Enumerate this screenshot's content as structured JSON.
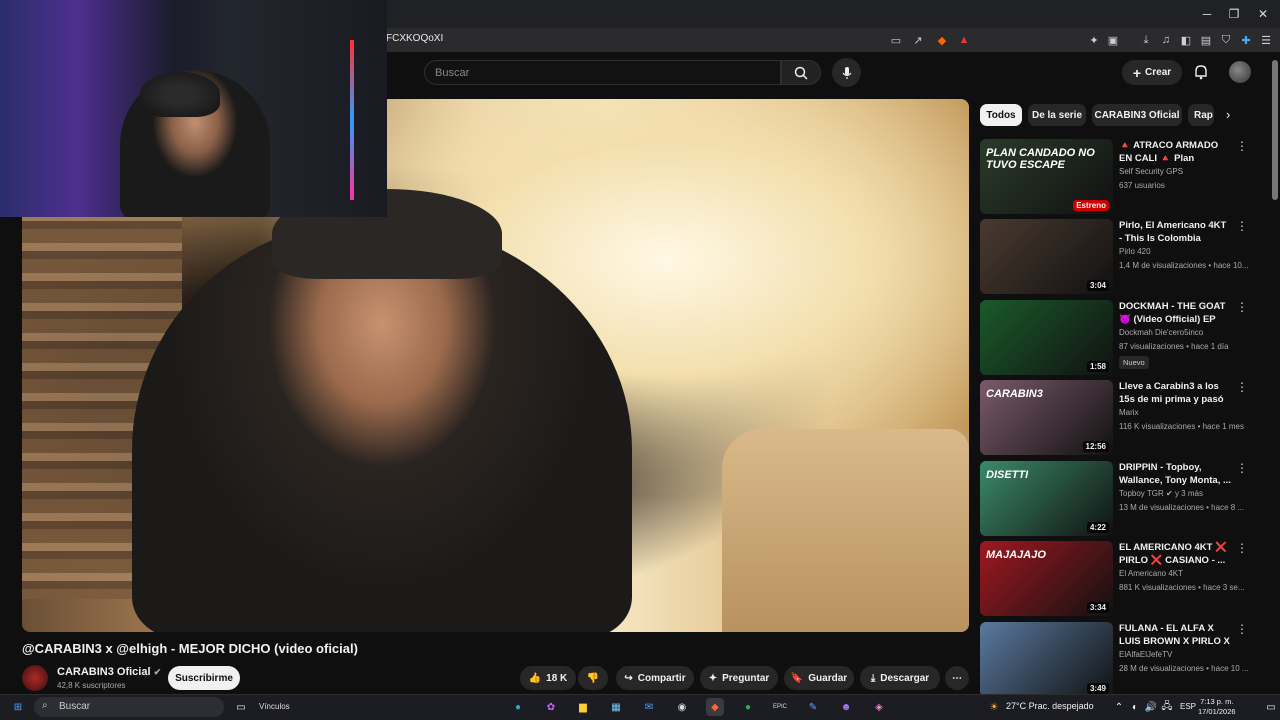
{
  "browser": {
    "url_fragment": "FCXKOQoXI"
  },
  "header": {
    "search_placeholder": "Buscar",
    "create_label": "Crear"
  },
  "video": {
    "title": "@CARABIN3 x @elhigh - MEJOR DICHO (video oficial)"
  },
  "channel": {
    "name": "CARABIN3 Oficial",
    "subscribers": "42,8 K suscriptores",
    "subscribe_label": "Suscribirme"
  },
  "actions": {
    "likes": "18 K",
    "share": "Compartir",
    "ask": "Preguntar",
    "save": "Guardar",
    "download": "Descargar"
  },
  "chips": [
    "Todos",
    "De la serie",
    "CARABIN3 Oficial",
    "Rap"
  ],
  "recommendations": [
    {
      "title": "🔺 ATRACO ARMADO EN CALI 🔺 Plan Candado ...",
      "channel": "Self Security GPS",
      "meta": "637 usuarios",
      "badge_thumb": "Estreno",
      "thumb_text": "PLAN CANDADO NO TUVO ESCAPE",
      "thumb_color": "#2a3a2a"
    },
    {
      "title": "Pirlo, El Americano 4KT - This Is Colombia (Video ...",
      "channel": "Pirlo 420",
      "meta": "1,4 M de visualizaciones • hace 10...",
      "duration": "3:04",
      "thumb_color": "#4a3a30"
    },
    {
      "title": "DOCKMAH - THE GOAT 😈 (Video Official) EP SLOW ...",
      "channel": "Dockmah Die'cero5inco",
      "meta": "87 visualizaciones • hace 1 día",
      "badge": "Nuevo",
      "duration": "1:58",
      "thumb_color": "#1a5a2a"
    },
    {
      "title": "Lleve a Carabin3 a los 15s de mi prima y pasó esto...",
      "channel": "Marix",
      "meta": "116 K visualizaciones • hace 1 mes",
      "duration": "12:56",
      "thumb_text": "CARABIN3",
      "thumb_color": "#7a5a6a"
    },
    {
      "title": "DRIPPIN - Topboy, Wallance, Tony Monta, ...",
      "channel": "Topboy TGR",
      "meta": "13 M de visualizaciones • hace 8 ...",
      "channel_extra": "y 3 más",
      "duration": "4:22",
      "thumb_text": "DISETTI",
      "thumb_color": "#3a8a6a"
    },
    {
      "title": "EL AMERICANO 4KT ❌ PIRLO ❌ CASIANO - ...",
      "channel": "El Americano 4KT",
      "meta": "881 K visualizaciones • hace 3 se...",
      "duration": "3:34",
      "thumb_text": "MAJAJAJO",
      "thumb_color": "#a01820"
    },
    {
      "title": "FULANA - EL ALFA X LUIS BROWN X PIRLO X CHAE...",
      "channel": "ElAlfaElJefeTV",
      "meta": "28 M de visualizaciones • hace 10 ...",
      "duration": "3:49",
      "thumb_color": "#5a7aa0"
    }
  ],
  "taskbar": {
    "search_placeholder": "Buscar",
    "links_label": "Vínculos",
    "weather": "27°C  Prac. despejado",
    "lang": "ESP",
    "time": "7:13 p. m.",
    "date": "17/01/2026"
  }
}
